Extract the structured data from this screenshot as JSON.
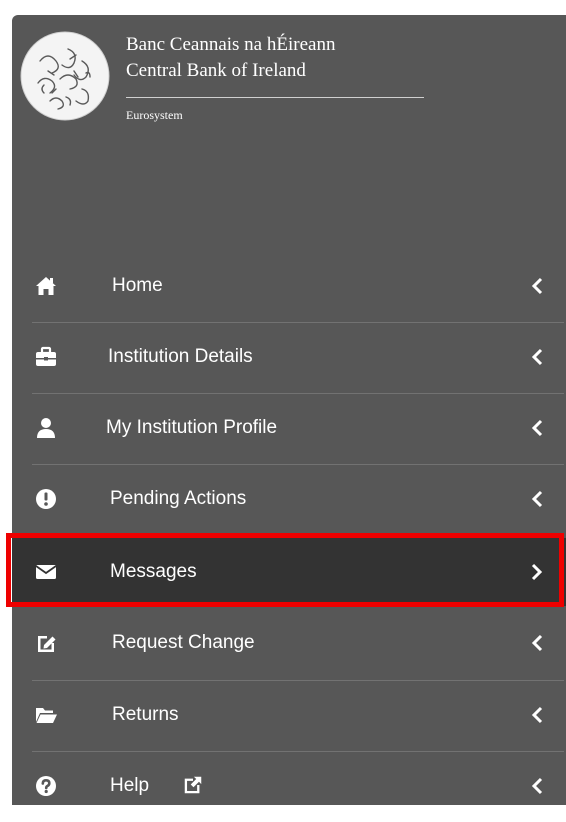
{
  "logo": {
    "irish_name": "Banc Ceannais na hÉireann",
    "english_name": "Central Bank of Ireland",
    "subtitle": "Eurosystem"
  },
  "menu": {
    "items": [
      {
        "label": "Home",
        "icon": "home-icon",
        "state": "collapsed"
      },
      {
        "label": "Institution Details",
        "icon": "briefcase-icon",
        "state": "collapsed"
      },
      {
        "label": "My Institution Profile",
        "icon": "user-icon",
        "state": "collapsed"
      },
      {
        "label": "Pending Actions",
        "icon": "exclamation-circle-icon",
        "state": "collapsed"
      },
      {
        "label": "Messages",
        "icon": "envelope-icon",
        "state": "active"
      },
      {
        "label": "Request Change",
        "icon": "edit-icon",
        "state": "collapsed"
      },
      {
        "label": "Returns",
        "icon": "folder-open-icon",
        "state": "collapsed"
      },
      {
        "label": "Help",
        "icon": "question-circle-icon",
        "extra_icon": "external-link-icon",
        "state": "collapsed"
      }
    ]
  },
  "colors": {
    "sidebar_bg": "#575757",
    "active_bg": "#333333",
    "highlight": "#ee0000",
    "text": "#ffffff"
  }
}
